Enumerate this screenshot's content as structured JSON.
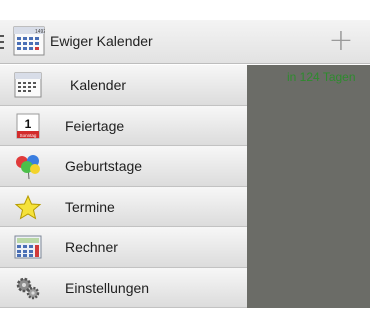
{
  "appbar": {
    "title": "Ewiger Kalender",
    "add_symbol": "+"
  },
  "content": {
    "days_text": "in 124 Tagen"
  },
  "drawer": {
    "items": [
      {
        "label": "Kalender",
        "icon": "calendar-icon"
      },
      {
        "label": "Feiertage",
        "icon": "holiday-calendar-icon"
      },
      {
        "label": "Geburtstage",
        "icon": "balloons-icon"
      },
      {
        "label": "Termine",
        "icon": "star-icon"
      },
      {
        "label": "Rechner",
        "icon": "calculator-icon"
      },
      {
        "label": "Einstellungen",
        "icon": "gears-icon"
      }
    ]
  },
  "icons": {
    "logo_header": "1492",
    "holiday_number": "1",
    "holiday_word": "Sonntag"
  },
  "colors": {
    "content_bg": "#6b6c67",
    "days_text": "#2e8b2e",
    "star": "#f5e23a"
  }
}
